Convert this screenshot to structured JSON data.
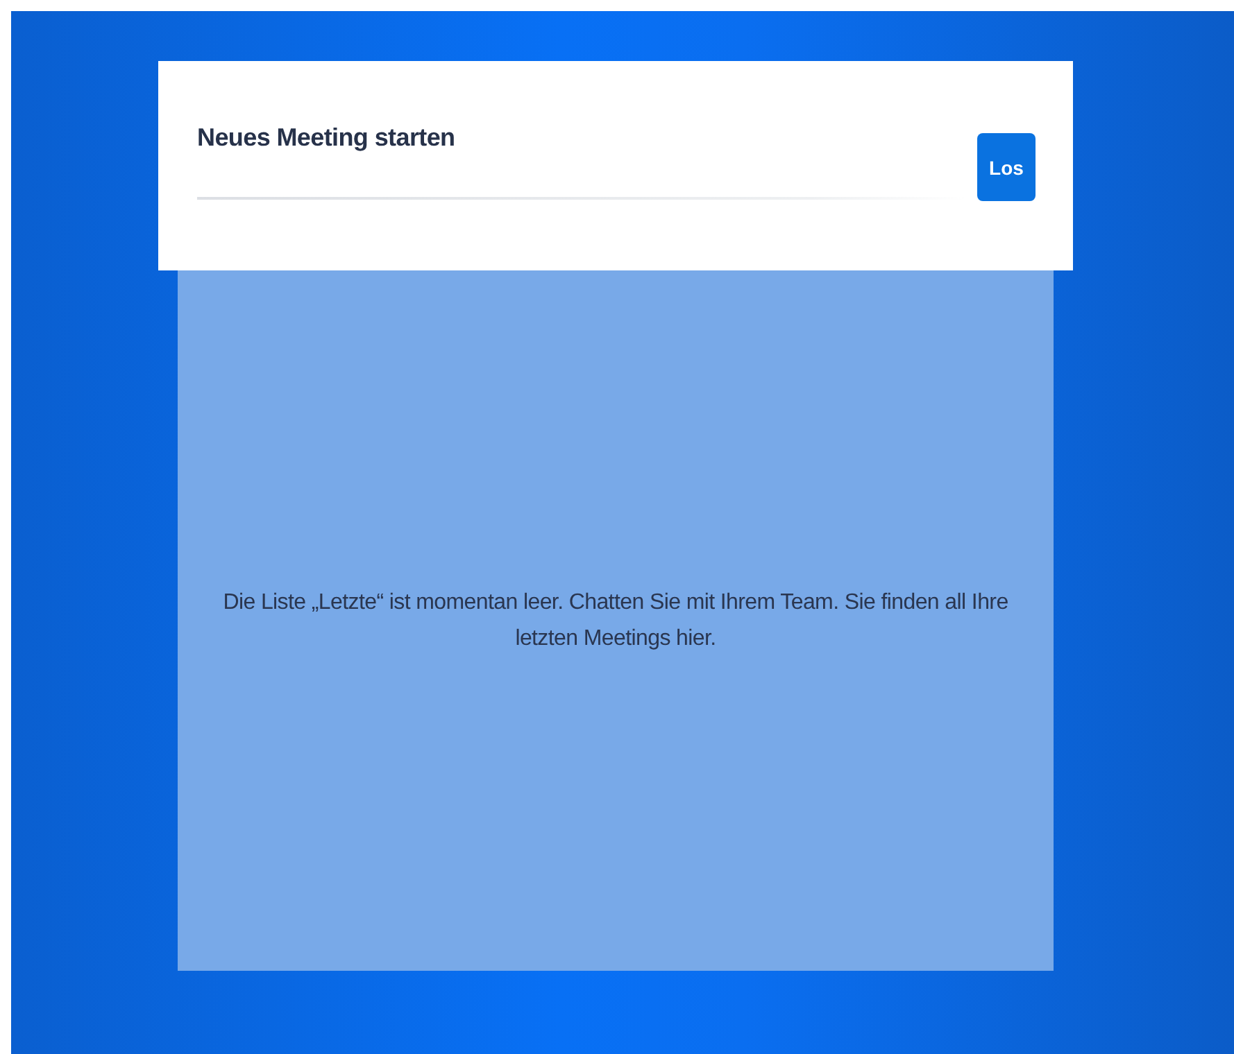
{
  "header": {
    "title": "Neues Meeting starten",
    "button": "Los"
  },
  "empty_message": "Die Liste „Letzte“ ist momentan leer. Chatten Sie mit Ihrem Team. Sie finden all Ihre letzten Meetings hier."
}
